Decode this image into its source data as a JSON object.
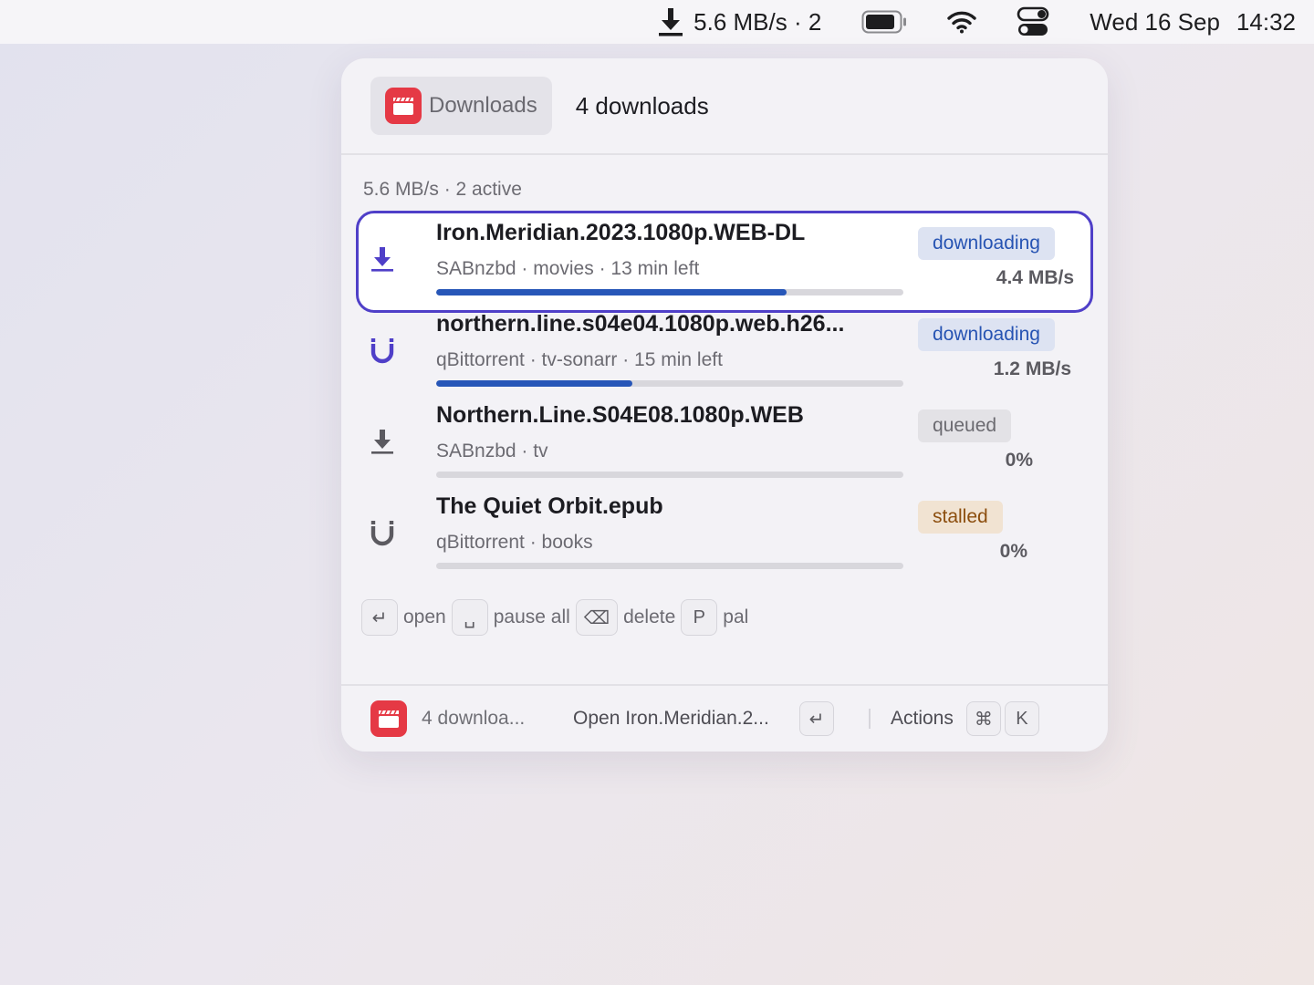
{
  "menubar": {
    "download_status": "5.6 MB/s · 2",
    "date": "Wed 16 Sep",
    "time": "14:32",
    "icons": [
      "download-icon",
      "battery-icon",
      "wifi-icon",
      "control-center-icon"
    ]
  },
  "header": {
    "command_label": "Downloads",
    "title": "4 downloads"
  },
  "section": {
    "title": "5.6 MB/s · 2 active"
  },
  "downloads": [
    {
      "title": "Iron.Meridian.2023.1080p.WEB-DL",
      "subtitle": "SABnzbd · movies · 13 min left",
      "status": "downloading",
      "rate": "4.4 MB/s",
      "progress": 0.75,
      "client_icon": "download-icon",
      "selected": true
    },
    {
      "title": "northern.line.s04e04.1080p.web.h26...",
      "subtitle": "qBittorrent · tv-sonarr · 15 min left",
      "status": "downloading",
      "rate": "1.2 MB/s",
      "progress": 0.42,
      "client_icon": "magnet-icon",
      "selected": false
    },
    {
      "title": "Northern.Line.S04E08.1080p.WEB",
      "subtitle": "SABnzbd · tv",
      "status": "queued",
      "rate": "0%",
      "progress": 0,
      "client_icon": "download-icon",
      "selected": false
    },
    {
      "title": "The Quiet Orbit.epub",
      "subtitle": "qBittorrent · books",
      "status": "stalled",
      "rate": "0%",
      "progress": 0,
      "client_icon": "magnet-icon",
      "selected": false
    }
  ],
  "hints": {
    "open_key": "↵",
    "open_label": "open",
    "pause_key": "␣",
    "pause_label": "pause all",
    "delete_key": "⌫",
    "delete_label": "delete",
    "pal_key": "P",
    "pal_label": "pal"
  },
  "footer": {
    "app_name": "4 downloa...",
    "primary_action": "Open Iron.Meridian.2...",
    "primary_key": "↵",
    "actions_label": "Actions",
    "actions_key1": "⌘",
    "actions_key2": "K"
  },
  "colors": {
    "selection": "#4f3fc8",
    "progress": "#2756b8",
    "app_icon": "#e53945",
    "badge_downloading_bg": "#dde3f2",
    "badge_downloading_fg": "#2754b3",
    "badge_queued_bg": "#e3e2e6",
    "badge_stalled_bg": "#f1e3d2",
    "badge_stalled_fg": "#8c4e0e"
  }
}
